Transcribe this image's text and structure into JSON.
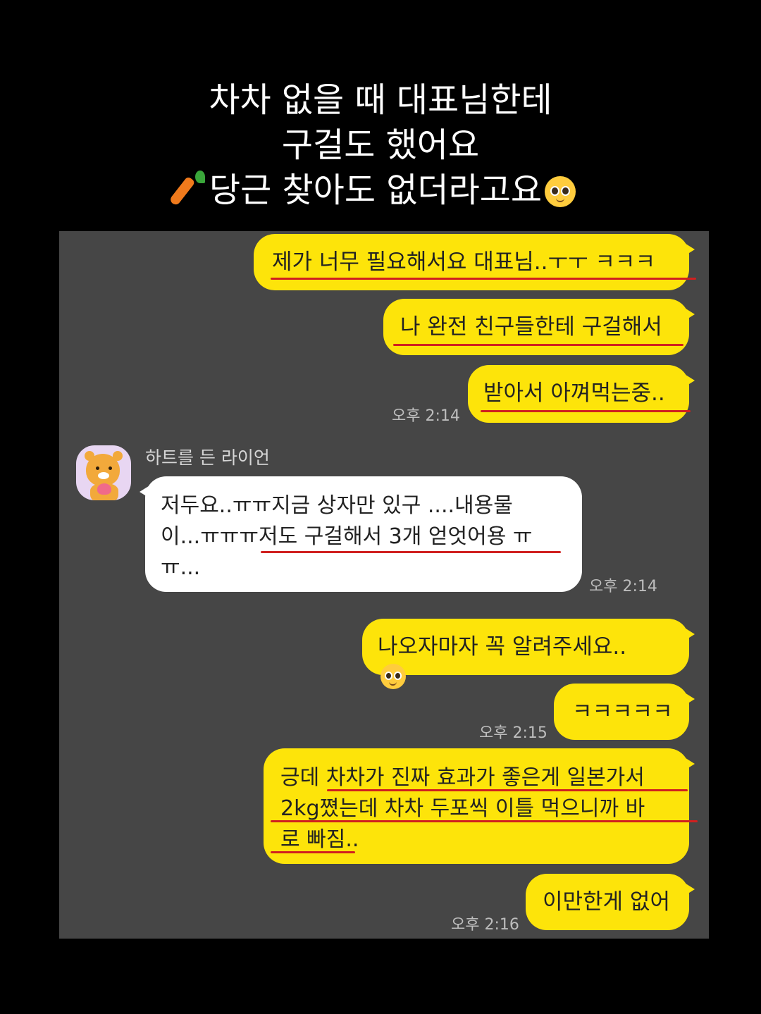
{
  "caption": {
    "line1": "차차 없을 때 대표님한테",
    "line2": "구걸도 했어요",
    "line3": "당근 찾아도 없더라고요"
  },
  "icons": {
    "carrot": "carrot-emoji",
    "pleading_face": "pleading-face-emoji",
    "avatar": "ryan-lion-heart-avatar"
  },
  "colors": {
    "background": "#000000",
    "chat_bg": "#464646",
    "my_bubble": "#fde40a",
    "their_bubble": "#ffffff",
    "underline": "#d0201f"
  },
  "chat": {
    "sender_name": "하트를 든 라이언",
    "messages": [
      {
        "from": "me",
        "text": "제가 너무 필요해서요 대표님..ㅜㅜ ㅋㅋㅋ"
      },
      {
        "from": "me",
        "text": "나 완전 친구들한테 구걸해서"
      },
      {
        "from": "me",
        "text": "받아서 아껴먹는중..",
        "time": "오후 2:14"
      },
      {
        "from": "them",
        "line1": "저두요..ㅠㅠ지금 상자만 있구 ....내용물",
        "line2": "이...ㅠㅠㅠ저도 구걸해서 3개 얻엇어용 ㅠ",
        "line3": "ㅠ...",
        "time": "오후 2:14"
      },
      {
        "from": "me",
        "text": "나오자마자 꼭 알려주세요.."
      },
      {
        "from": "me",
        "text": "ㅋㅋㅋㅋㅋ",
        "time": "오후 2:15"
      },
      {
        "from": "me",
        "line1": "긍데 차차가 진짜 효과가 좋은게 일본가서",
        "line2": "2kg쪘는데 차차 두포씩 이틀 먹으니까 바",
        "line3": "로 빠짐.."
      },
      {
        "from": "me",
        "text": "이만한게 없어",
        "time": "오후 2:16"
      }
    ]
  }
}
